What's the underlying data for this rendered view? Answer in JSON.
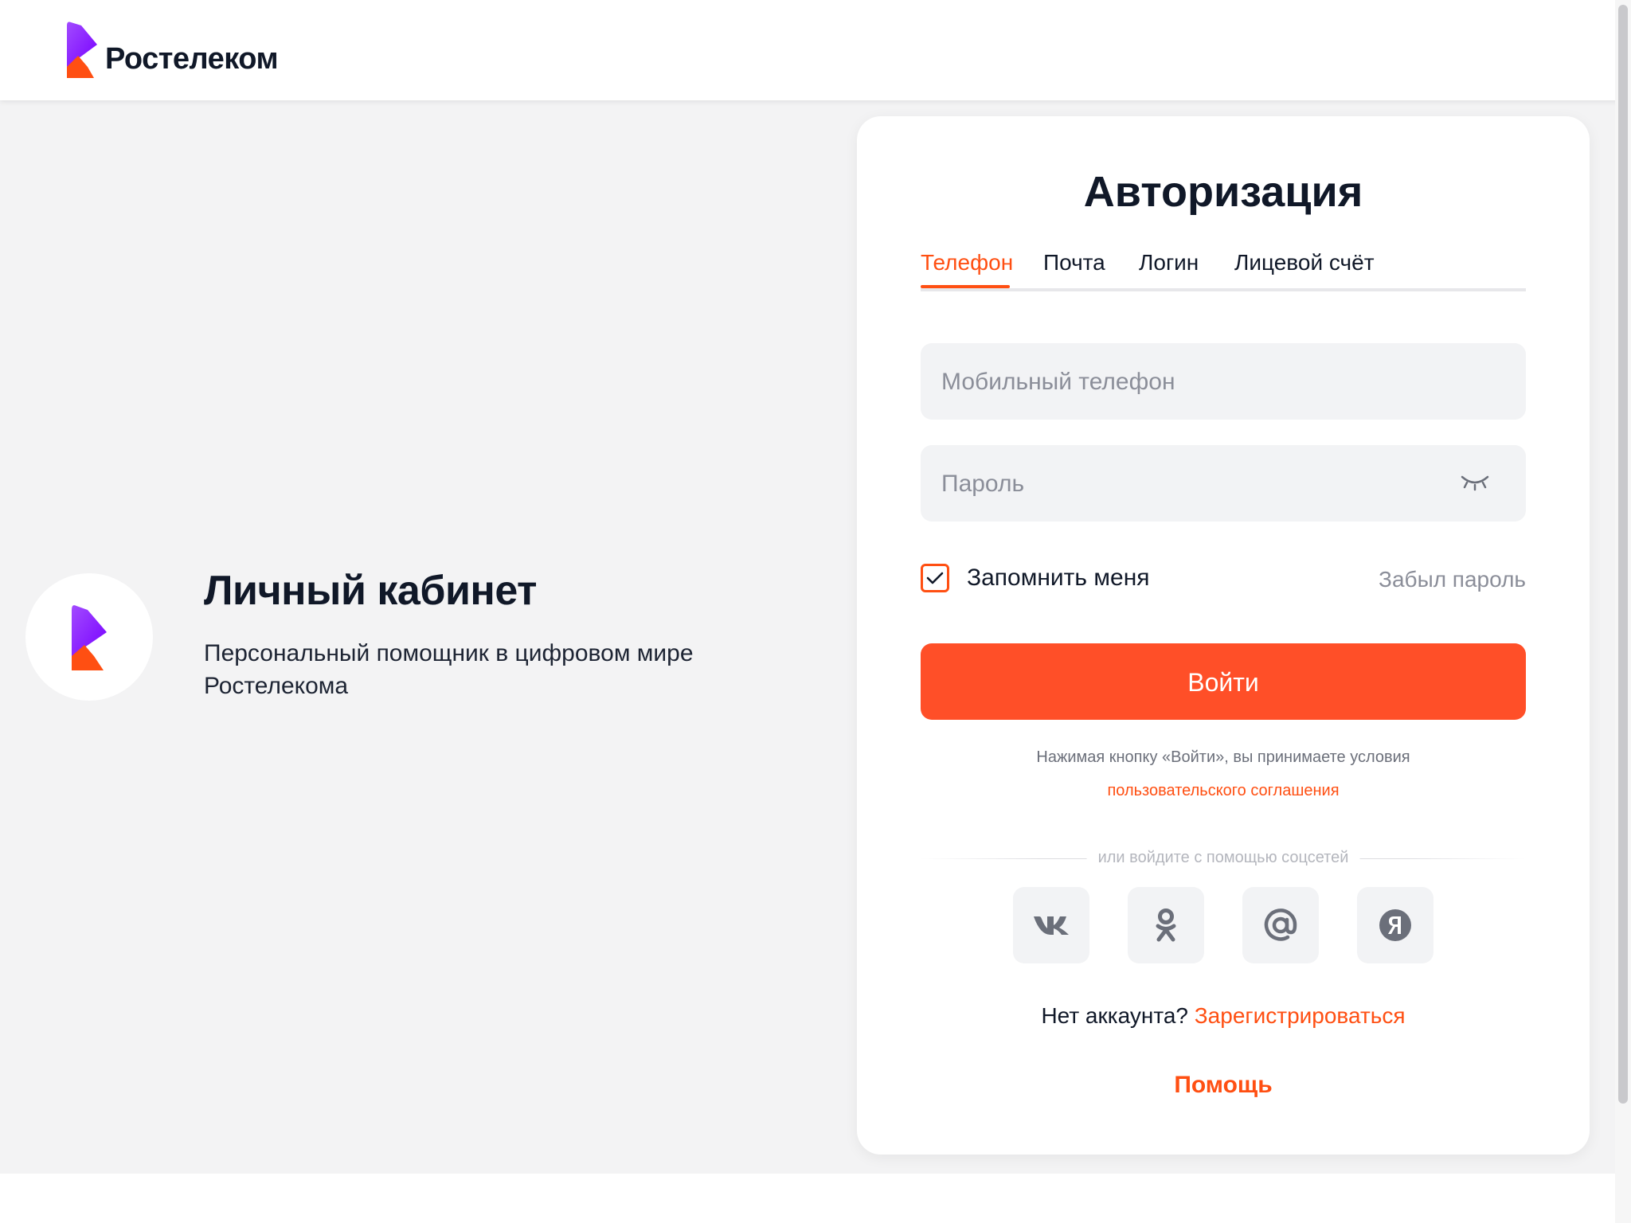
{
  "header": {
    "logo_text": "Ростелеком"
  },
  "promo": {
    "title": "Личный кабинет",
    "subtitle": "Персональный помощник в цифровом мире Ростелекома"
  },
  "auth": {
    "title": "Авторизация",
    "tabs": [
      {
        "label": "Телефон",
        "active": true
      },
      {
        "label": "Почта",
        "active": false
      },
      {
        "label": "Логин",
        "active": false
      },
      {
        "label": "Лицевой счёт",
        "active": false
      }
    ],
    "phone_placeholder": "Мобильный телефон",
    "phone_value": "",
    "password_placeholder": "Пароль",
    "password_value": "",
    "remember_label": "Запомнить меня",
    "remember_checked": true,
    "forgot_label": "Забыл пароль",
    "login_label": "Войти",
    "terms_text": "Нажимая кнопку «Войти», вы принимаете условия",
    "terms_link": "пользовательского соглашения",
    "social_divider": "или войдите с помощью соцсетей",
    "social": [
      {
        "icon": "vk-icon"
      },
      {
        "icon": "odnoklassniki-icon"
      },
      {
        "icon": "mailru-icon"
      },
      {
        "icon": "yandex-icon"
      }
    ],
    "no_account": "Нет аккаунта?",
    "register_label": "Зарегистрироваться",
    "help_label": "Помощь"
  },
  "colors": {
    "accent": "#ff4f12",
    "button": "#ff4f28",
    "logo_purple": "#7700ff",
    "background": "#f3f3f4"
  }
}
